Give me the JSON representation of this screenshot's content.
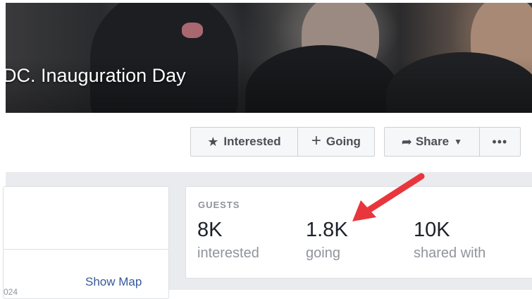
{
  "cover": {
    "title": "DC. Inauguration Day"
  },
  "actions": {
    "interested_label": "Interested",
    "going_label": "Going",
    "share_label": "Share",
    "icons": {
      "interested": "star-icon",
      "going": "plus-icon",
      "share": "share-arrow-icon",
      "share_menu": "caret-down-icon",
      "more": "ellipsis-icon"
    }
  },
  "details": {
    "show_map_label": "Show Map",
    "cut_text": "024"
  },
  "guests": {
    "heading": "GUESTS",
    "stats": [
      {
        "value": "8K",
        "label": "interested"
      },
      {
        "value": "1.8K",
        "label": "going"
      },
      {
        "value": "10K",
        "label": "shared with"
      }
    ]
  },
  "colors": {
    "annotation_arrow": "#e8363c",
    "link": "#365899",
    "button_text": "#4b4f56",
    "muted_text": "#90949c",
    "page_background": "#e9ebee"
  }
}
